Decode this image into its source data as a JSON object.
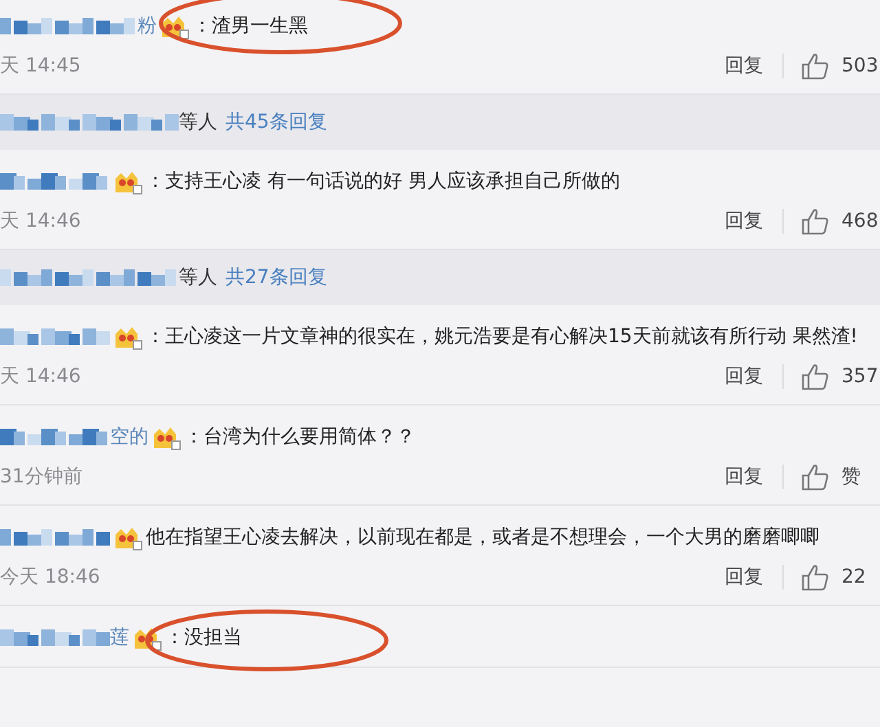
{
  "items": [
    {
      "kind": "comment",
      "name_suffix": "粉",
      "text": "：渣男一生黑",
      "time": "天 14:45",
      "reply": "回复",
      "likes": "503",
      "circled": true
    },
    {
      "kind": "summary",
      "names": "等人",
      "link": "共45条回复"
    },
    {
      "kind": "comment",
      "text": "：支持王心凌 有一句话说的好 男人应该承担自己所做的",
      "time": "天 14:46",
      "reply": "回复",
      "likes": "468",
      "circled": false
    },
    {
      "kind": "summary",
      "names": "等人",
      "link": "共27条回复"
    },
    {
      "kind": "comment",
      "text": "：王心凌这一片文章神的很实在，姚元浩要是有心解决15天前就该有所行动 果然渣!",
      "time": "天 14:46",
      "reply": "回复",
      "likes": "357",
      "circled": false
    },
    {
      "kind": "comment",
      "name_suffix": "空的",
      "text": "：台湾为什么要用简体？？",
      "time": "31分钟前",
      "reply": "回复",
      "likes": "赞",
      "circled": false
    },
    {
      "kind": "comment",
      "text": "他在指望王心凌去解决，以前现在都是，或者是不想理会，一个大男的磨磨唧唧",
      "time": "今天 18:46",
      "reply": "回复",
      "likes": "22",
      "circled": false
    },
    {
      "kind": "comment",
      "name_suffix": "莲",
      "text": "：没担当",
      "circled": true
    }
  ]
}
